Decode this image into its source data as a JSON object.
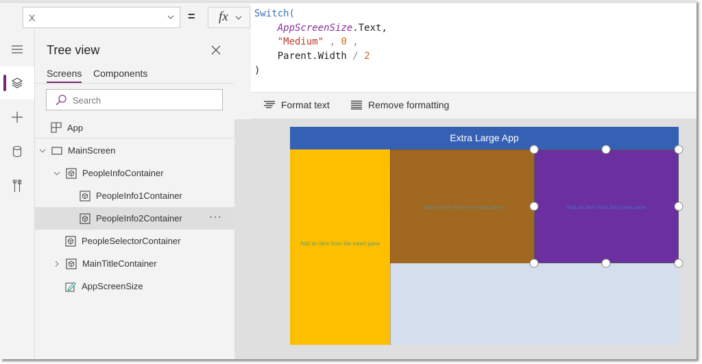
{
  "formula_bar": {
    "property": "X",
    "equals": "=",
    "fx_label": "fx",
    "code_lines": {
      "l1_fn": "Switch(",
      "l2_id": "AppScreenSize",
      "l2_rest": ".Text,",
      "l3_str": "\"Medium\"",
      "l3_sep1": " , ",
      "l3_num": "0",
      "l3_sep2": " ,",
      "l4_a": "Parent.Width",
      "l4_op": " / ",
      "l4_num": "2",
      "l5": ")"
    },
    "toolbar": {
      "format_text": "Format text",
      "remove_formatting": "Remove formatting"
    }
  },
  "rail": {
    "items": [
      {
        "name": "menu",
        "icon": "hamburger-icon"
      },
      {
        "name": "tree-view",
        "icon": "layers-icon",
        "active": true
      },
      {
        "name": "insert",
        "icon": "plus-icon"
      },
      {
        "name": "data",
        "icon": "database-icon"
      },
      {
        "name": "tools",
        "icon": "tools-icon"
      }
    ]
  },
  "tree_view": {
    "title": "Tree view",
    "tabs": [
      {
        "label": "Screens",
        "active": true
      },
      {
        "label": "Components",
        "active": false
      }
    ],
    "search_placeholder": "Search",
    "app_label": "App",
    "nodes": [
      {
        "label": "MainScreen",
        "type": "screen",
        "expander": "expanded"
      },
      {
        "label": "PeopleInfoContainer",
        "type": "container",
        "expander": "expanded"
      },
      {
        "label": "PeopleInfo1Container",
        "type": "container",
        "expander": "none"
      },
      {
        "label": "PeopleInfo2Container",
        "type": "container",
        "expander": "none",
        "selected": true,
        "more": "···"
      },
      {
        "label": "PeopleSelectorContainer",
        "type": "container",
        "expander": "none"
      },
      {
        "label": "MainTitleContainer",
        "type": "container",
        "expander": "collapsed"
      },
      {
        "label": "AppScreenSize",
        "type": "label",
        "expander": "none"
      }
    ]
  },
  "canvas": {
    "title": "Extra Large App",
    "yellow_hint": "Add an item from the insert pane",
    "brown_hint": "Add an item from the insert pane",
    "purple_hint": "Add an item from the insert pane",
    "colors": {
      "title_bar": "#3561b5",
      "yellow": "#fdbf00",
      "brown": "#a06820",
      "purple": "#6c2fa0",
      "background": "#d4deec",
      "accent": "#742774"
    }
  }
}
